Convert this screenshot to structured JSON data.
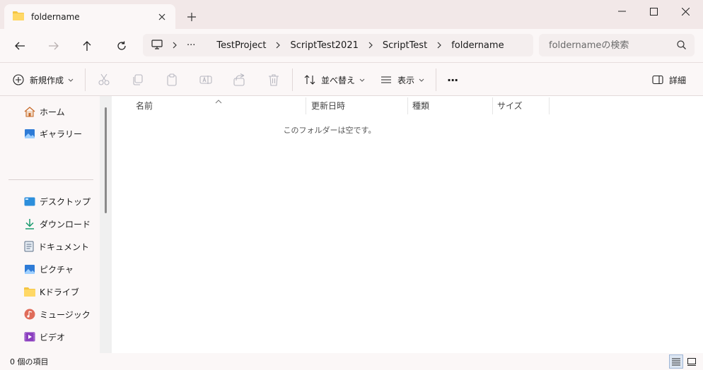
{
  "window": {
    "tab_title": "foldername"
  },
  "address_bar": {
    "overflow": "···",
    "crumbs": [
      "TestProject",
      "ScriptTest2021",
      "ScriptTest",
      "foldername"
    ]
  },
  "search": {
    "placeholder": "foldernameの検索"
  },
  "commands": {
    "new": "新規作成",
    "sort": "並べ替え",
    "view": "表示",
    "more": "···",
    "details": "詳細"
  },
  "sidebar": {
    "top": [
      {
        "label": "ホーム",
        "icon": "home-icon"
      },
      {
        "label": "ギャラリー",
        "icon": "gallery-icon"
      }
    ],
    "pinned": [
      {
        "label": "デスクトップ",
        "icon": "desktop-icon"
      },
      {
        "label": "ダウンロード",
        "icon": "download-icon"
      },
      {
        "label": "ドキュメント",
        "icon": "document-icon"
      },
      {
        "label": "ピクチャ",
        "icon": "pictures-icon"
      },
      {
        "label": "Kドライブ",
        "icon": "folder-icon"
      },
      {
        "label": "ミュージック",
        "icon": "music-icon"
      },
      {
        "label": "ビデオ",
        "icon": "video-icon"
      }
    ]
  },
  "columns": [
    "名前",
    "更新日時",
    "種類",
    "サイズ"
  ],
  "empty_message": "このフォルダーは空です。",
  "status": {
    "item_count": "0 個の項目"
  },
  "colors": {
    "folder": "#f4c542",
    "accent": "#0067c0",
    "titlebar": "#f2e8e8"
  }
}
